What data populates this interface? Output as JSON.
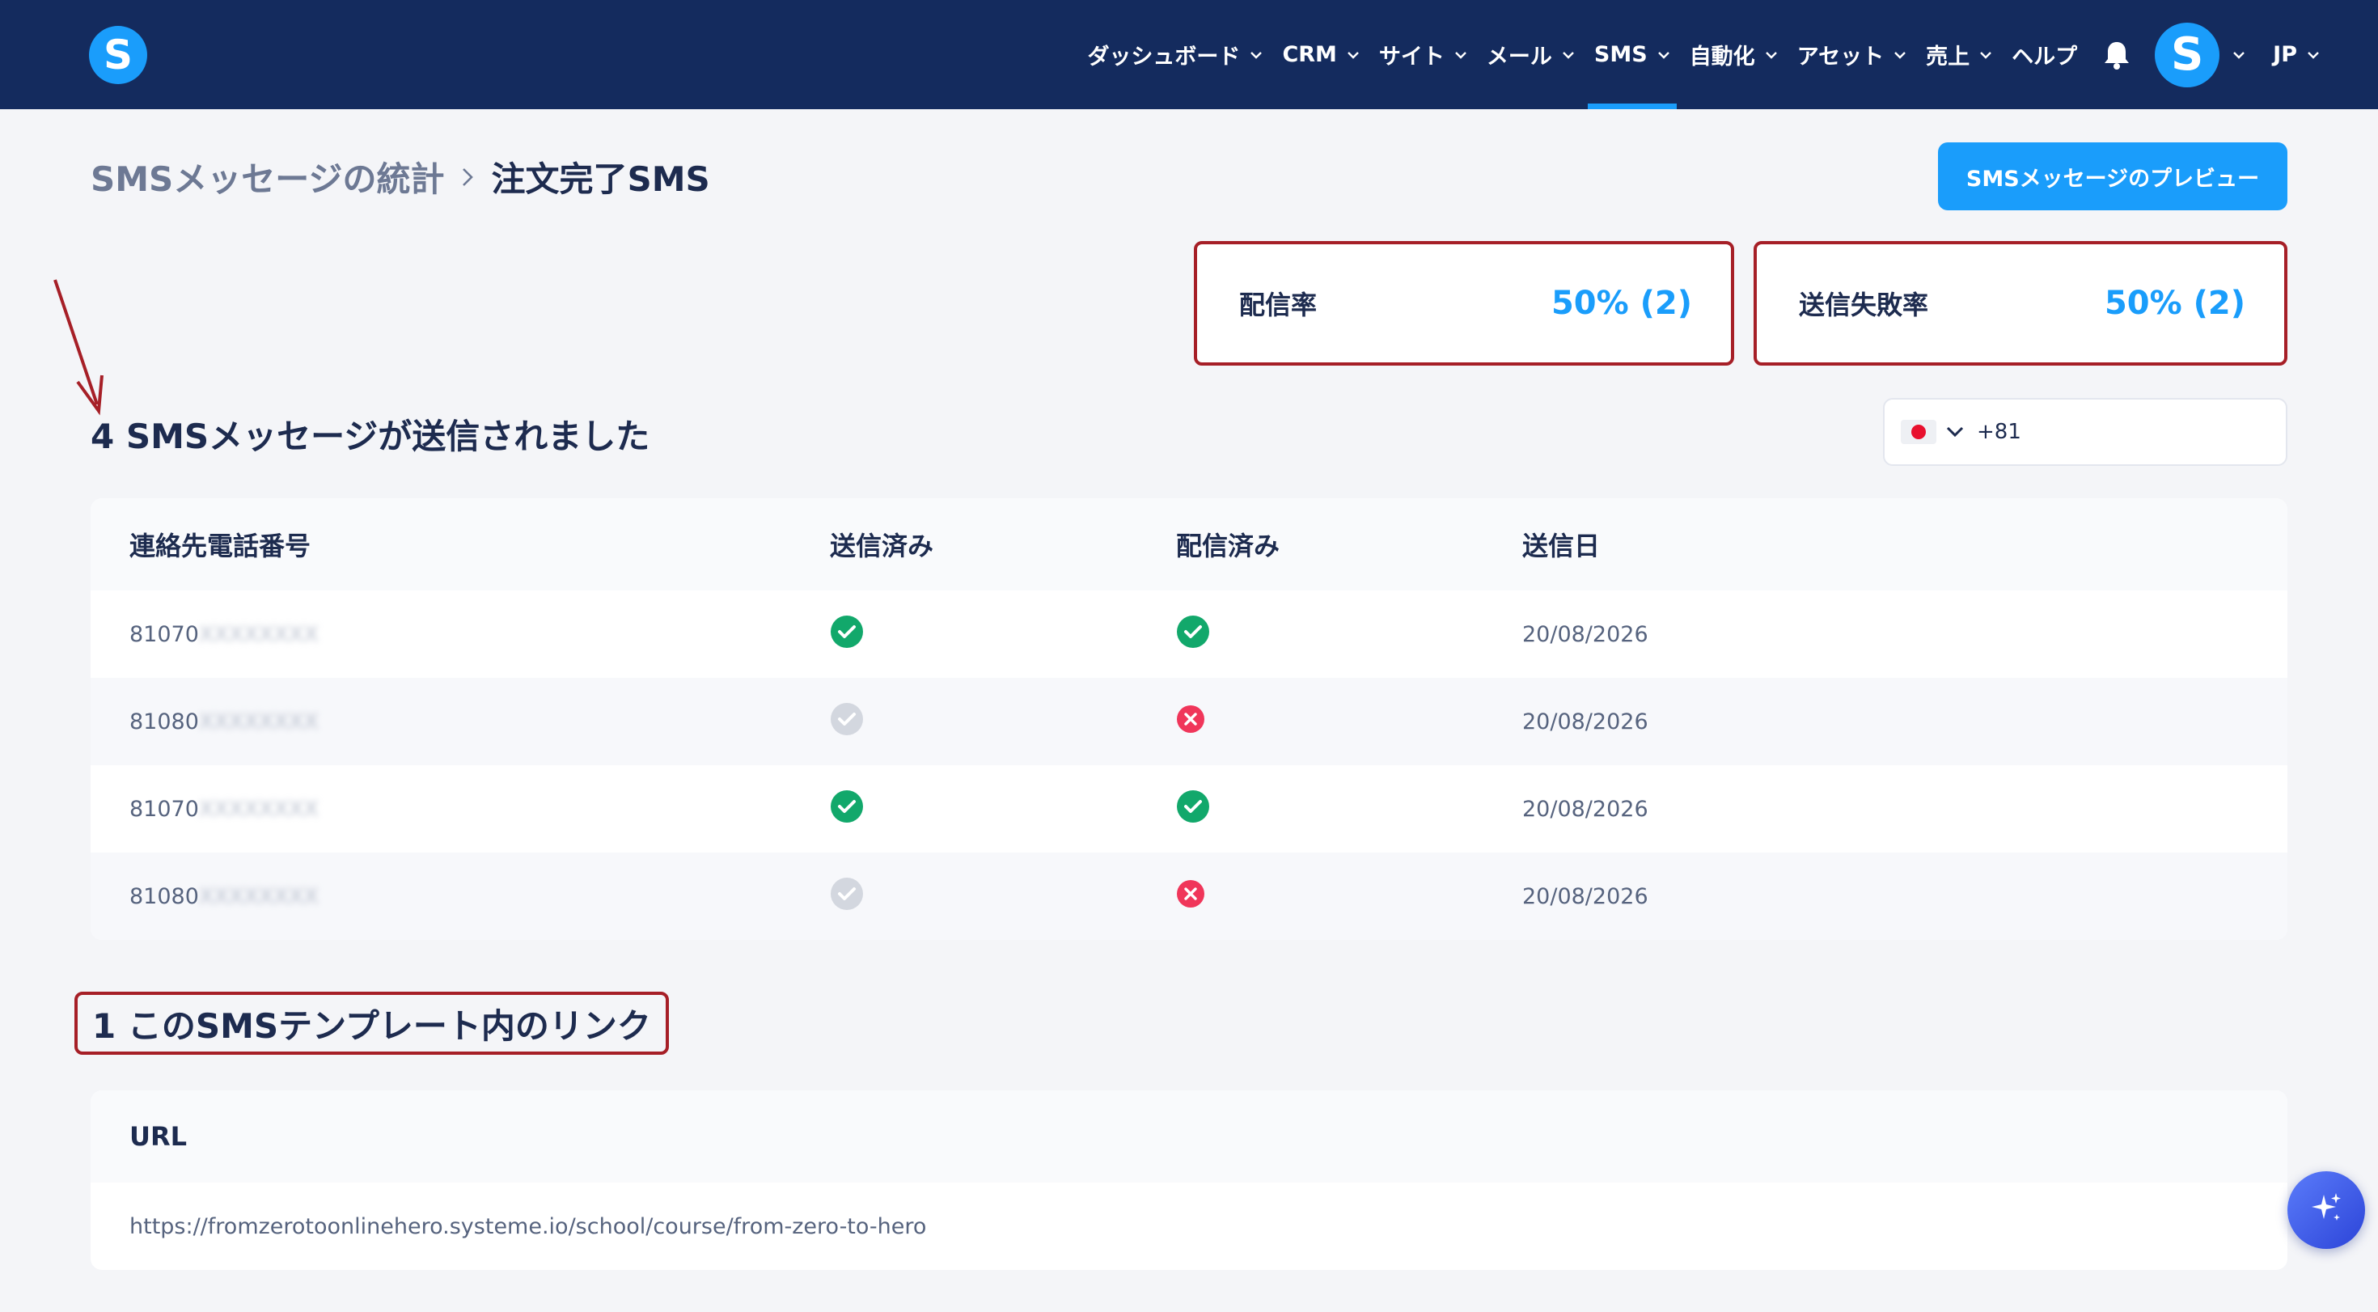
{
  "nav": {
    "logo": "S",
    "items": [
      {
        "label": "ダッシュボード",
        "active": false
      },
      {
        "label": "CRM",
        "active": false
      },
      {
        "label": "サイト",
        "active": false
      },
      {
        "label": "メール",
        "active": false
      },
      {
        "label": "SMS",
        "active": true
      },
      {
        "label": "自動化",
        "active": false
      },
      {
        "label": "アセット",
        "active": false
      },
      {
        "label": "売上",
        "active": false
      }
    ],
    "help": "ヘルプ",
    "avatar": "S",
    "language": "JP"
  },
  "header": {
    "breadcrumb_parent": "SMSメッセージの統計",
    "breadcrumb_current": "注文完了SMS",
    "preview_button": "SMSメッセージのプレビュー"
  },
  "stats": {
    "delivery_label": "配信率",
    "delivery_value": "50% (2)",
    "failure_label": "送信失敗率",
    "failure_value": "50% (2)"
  },
  "messages": {
    "title": "4 SMSメッセージが送信されました",
    "phone_filter": {
      "flag": "jp-flag",
      "code": "+81"
    },
    "columns": [
      "連絡先電話番号",
      "送信済み",
      "配信済み",
      "送信日"
    ],
    "rows": [
      {
        "phone_prefix": "81070",
        "phone_hidden": "XXXXXXXX",
        "sent": "check-green",
        "delivered": "check-green",
        "date": "20/08/2026"
      },
      {
        "phone_prefix": "81080",
        "phone_hidden": "XXXXXXXX",
        "sent": "check-gray",
        "delivered": "cross-red",
        "date": "20/08/2026"
      },
      {
        "phone_prefix": "81070",
        "phone_hidden": "XXXXXXXX",
        "sent": "check-green",
        "delivered": "check-green",
        "date": "20/08/2026"
      },
      {
        "phone_prefix": "81080",
        "phone_hidden": "XXXXXXXX",
        "sent": "check-gray",
        "delivered": "cross-red",
        "date": "20/08/2026"
      }
    ]
  },
  "links": {
    "title": "1 このSMSテンプレート内のリンク",
    "column": "URL",
    "rows": [
      "https://fromzerotoonlinehero.systeme.io/school/course/from-zero-to-hero"
    ]
  },
  "colors": {
    "nav_bg": "#142b5e",
    "accent": "#1a9dfb",
    "highlight_border": "#a61f27",
    "success": "#12a86b",
    "error": "#f0365a",
    "neutral_icon": "#d3d7df"
  },
  "icons": {
    "chevron": "chevron-down-icon",
    "bell": "bell-icon",
    "breadcrumb_sep": "chevron-right-icon",
    "ai": "sparkle-icon"
  }
}
